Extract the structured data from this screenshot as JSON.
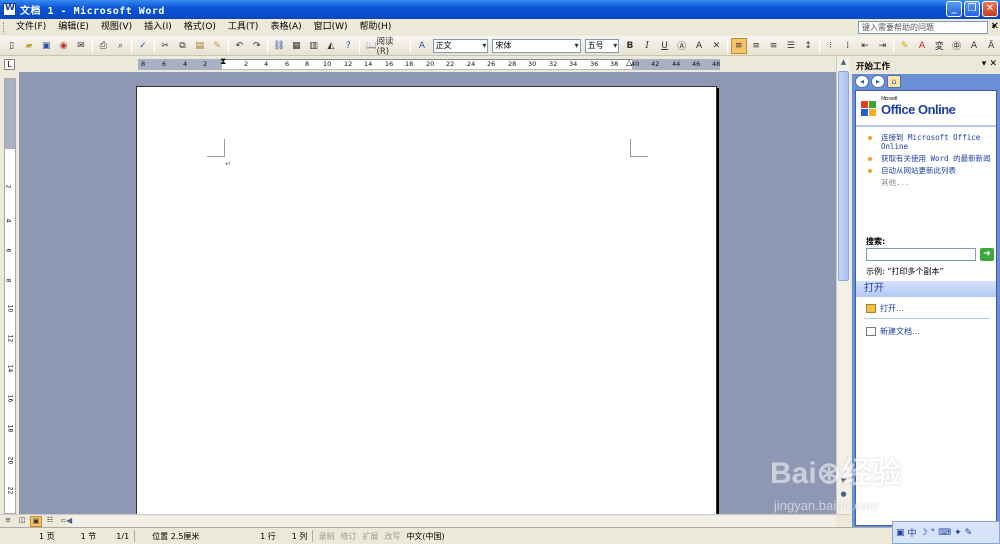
{
  "window": {
    "title": "文档 1 - Microsoft Word"
  },
  "menu": [
    "文件(F)",
    "编辑(E)",
    "视图(V)",
    "插入(I)",
    "格式(O)",
    "工具(T)",
    "表格(A)",
    "窗口(W)",
    "帮助(H)"
  ],
  "help": {
    "placeholder": "键入需要帮助的问题"
  },
  "toolbar": {
    "read_label": "阅读(R)",
    "style": "正文",
    "font": "宋体",
    "size": "五号"
  },
  "ruler": {
    "numbers": [
      "8",
      "6",
      "4",
      "2",
      "2",
      "4",
      "6",
      "8",
      "10",
      "12",
      "14",
      "16",
      "18",
      "20",
      "22",
      "24",
      "26",
      "28",
      "30",
      "32",
      "34",
      "36",
      "38",
      "40",
      "42",
      "44",
      "46",
      "48"
    ]
  },
  "vruler": {
    "numbers": [
      "2",
      "4",
      "6",
      "8",
      "10",
      "12",
      "14",
      "16",
      "18",
      "20",
      "22"
    ]
  },
  "document": {
    "paragraph_mark": "↵"
  },
  "taskpane": {
    "title": "开始工作",
    "logo_small": "Microsoft",
    "logo": "Office Online",
    "links": [
      "连接到 Microsoft Office Online",
      "获取有关使用 Word 的最新新闻",
      "自动从网站更新此列表"
    ],
    "other": "其他...",
    "search_label": "搜索:",
    "example": "示例: “打印多个副本”",
    "open_header": "打开",
    "open_action": "打开...",
    "new_action": "新建文档..."
  },
  "status": {
    "page": "1 页",
    "section": "1 节",
    "pages": "1/1",
    "position": "位置 2.5厘米",
    "line": "1 行",
    "col": "1 列",
    "rec": "录制",
    "trk": "修订",
    "ext": "扩展",
    "ovr": "改写",
    "lang": "中文(中国)"
  },
  "tray": {
    "ime": "中"
  },
  "watermark": {
    "brand": "Bai⊛经验",
    "url": "jingyan.baidu.com"
  }
}
